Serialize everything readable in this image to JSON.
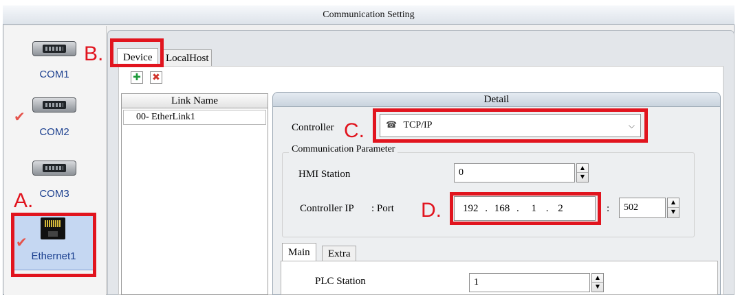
{
  "window": {
    "title": "Communication Setting"
  },
  "ports": [
    {
      "label": "COM1",
      "checked": false,
      "icon": "serial-port-icon"
    },
    {
      "label": "COM2",
      "checked": true,
      "icon": "serial-port-icon"
    },
    {
      "label": "COM3",
      "checked": false,
      "icon": "serial-port-icon"
    },
    {
      "label": "Ethernet1",
      "checked": true,
      "selected": true,
      "icon": "ethernet-port-icon"
    }
  ],
  "tabs": {
    "device": "Device",
    "localhost": "LocalHost"
  },
  "toolbar": {
    "add_icon": "add-link-icon",
    "delete_icon": "delete-link-icon"
  },
  "links": {
    "header": "Link Name",
    "items": [
      "00- EtherLink1"
    ]
  },
  "detail": {
    "header": "Detail",
    "controller_label": "Controller",
    "controller_value": "TCP/IP",
    "comm_group_label": "Communication Parameter",
    "hmi_station_label": "HMI Station",
    "hmi_station_value": "0",
    "controller_ip_label": "Controller IP",
    "port_label": ": Port",
    "ip": [
      "192",
      "168",
      "1",
      "2"
    ],
    "ip_dot": ".",
    "port_separator": ":",
    "port_value": "502",
    "subtabs": {
      "main": "Main",
      "extra": "Extra"
    },
    "plc_station_label": "PLC Station",
    "plc_station_value": "1"
  },
  "annotations": {
    "a": "A.",
    "b": "B.",
    "c": "C.",
    "d": "D."
  },
  "colors": {
    "highlight_red": "#e1141e",
    "check_red": "#e5534b",
    "port_label_blue": "#1b3f8f",
    "selected_bg": "#c5d7f2"
  }
}
